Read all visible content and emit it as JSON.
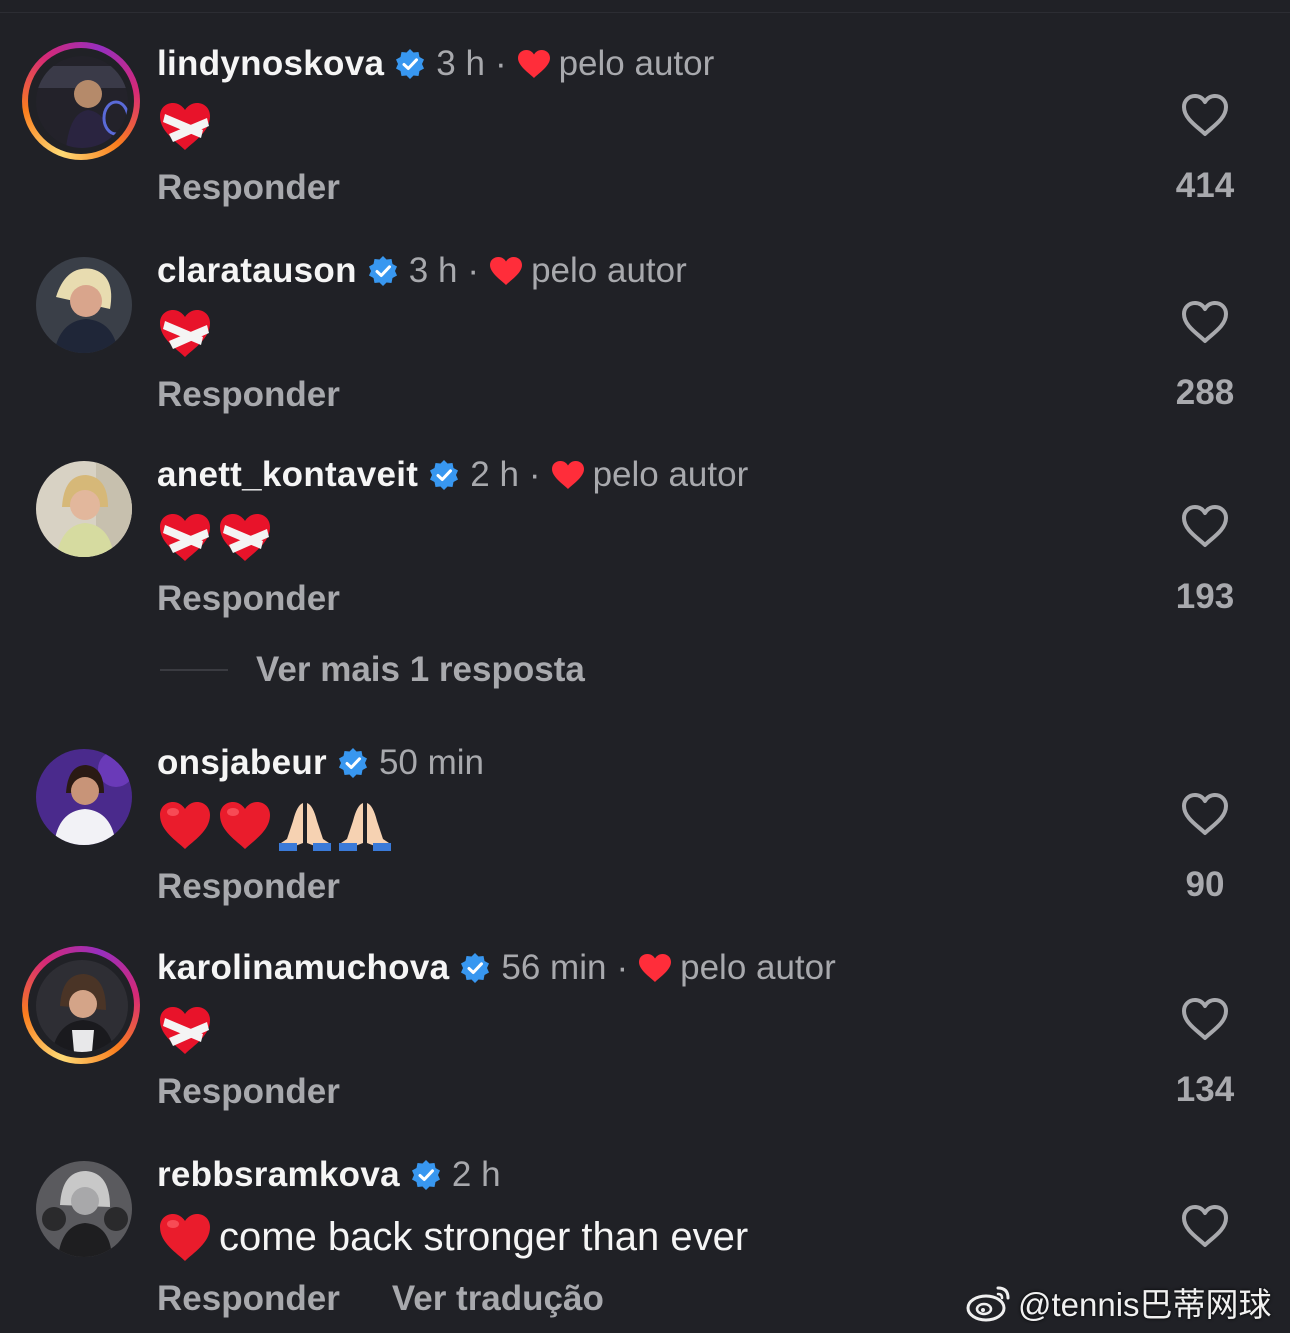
{
  "comments": [
    {
      "username": "lindynoskova",
      "time": "3 h",
      "liked_by_author_label": "pelo autor",
      "body_emojis": [
        "mending-heart"
      ],
      "body_text": "",
      "reply_label": "Responder",
      "likes": "414",
      "story_ring": true
    },
    {
      "username": "claratauson",
      "time": "3 h",
      "liked_by_author_label": "pelo autor",
      "body_emojis": [
        "mending-heart"
      ],
      "body_text": "",
      "reply_label": "Responder",
      "likes": "288",
      "story_ring": false
    },
    {
      "username": "anett_kontaveit",
      "time": "2 h",
      "liked_by_author_label": "pelo autor",
      "body_emojis": [
        "mending-heart",
        "mending-heart"
      ],
      "body_text": "",
      "reply_label": "Responder",
      "likes": "193",
      "story_ring": false,
      "more_replies": "Ver mais 1 resposta"
    },
    {
      "username": "onsjabeur",
      "time": "50 min",
      "liked_by_author_label": "",
      "body_emojis": [
        "red-heart",
        "red-heart",
        "folded-hands",
        "folded-hands"
      ],
      "body_text": "",
      "reply_label": "Responder",
      "likes": "90",
      "story_ring": false
    },
    {
      "username": "karolinamuchova",
      "time": "56 min",
      "liked_by_author_label": "pelo autor",
      "body_emojis": [
        "mending-heart"
      ],
      "body_text": "",
      "reply_label": "Responder",
      "likes": "134",
      "story_ring": true
    },
    {
      "username": "rebbsramkova",
      "time": "2 h",
      "liked_by_author_label": "",
      "body_emojis": [
        "red-heart"
      ],
      "body_text": "come back stronger than ever",
      "reply_label": "Responder",
      "translate_label": "Ver tradução",
      "likes": "",
      "story_ring": false
    }
  ],
  "watermark": "@tennis巴蒂网球",
  "colors": {
    "background": "#202126",
    "secondary_text": "#a8a9ad",
    "verified_blue": "#3897f0",
    "heart_red": "#ff2d3a"
  }
}
